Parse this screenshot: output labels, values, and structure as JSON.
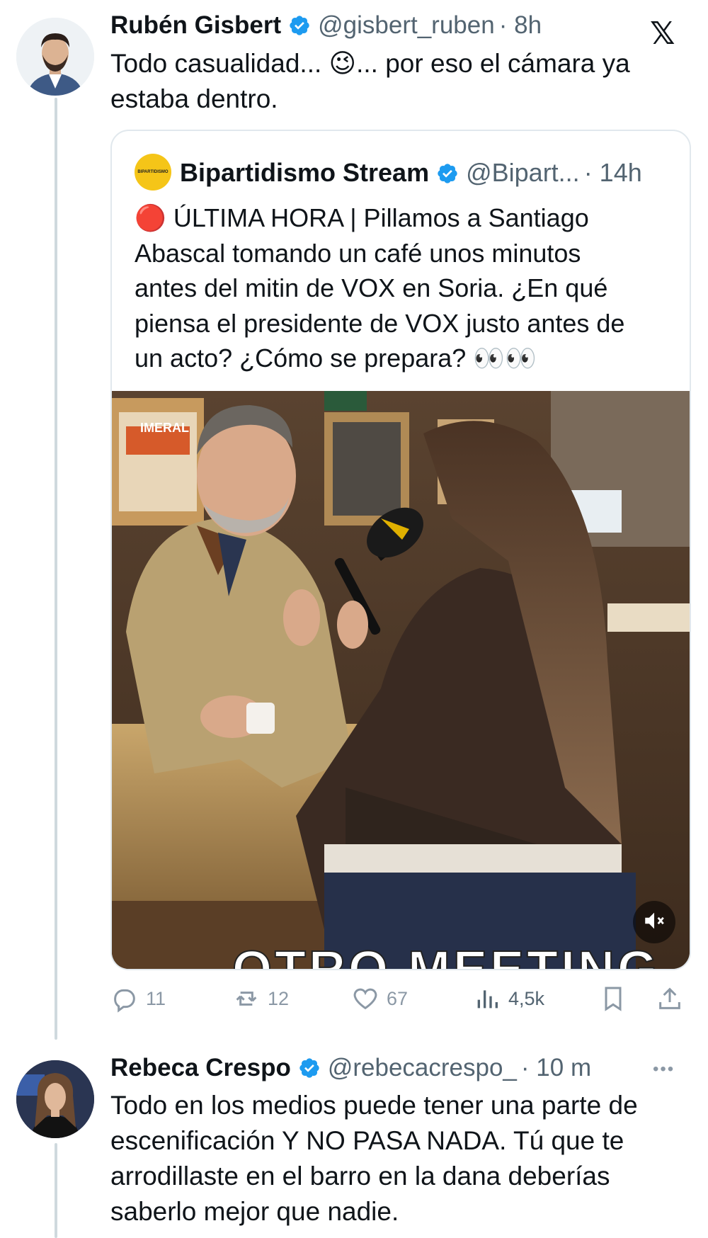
{
  "x_logo": "𝕏",
  "tweet1": {
    "name": "Rubén Gisbert",
    "handle": "@gisbert_ruben",
    "time": "· 8h",
    "text_lines": [
      "Todo casualidad... 😉... por eso el cámara ya",
      "estaba dentro."
    ],
    "quote": {
      "name": "Bipartidismo Stream",
      "handle": "@Bipart...",
      "time": "· 14h",
      "avatar_text": "BIPARTIDISMO",
      "text_lines": [
        "🔴 ÚLTIMA HORA | Pillamos a Santiago",
        "Abascal tomando un café unos minutos",
        "antes del mitin de VOX en Soria. ¿En qué",
        "piensa el presidente de VOX justo antes de",
        "un acto? ¿Cómo se prepara? 👀👀"
      ],
      "video_caption": "OTRO MEETING",
      "video_sign": "IMERAL"
    },
    "actions": {
      "replies": "11",
      "reposts": "12",
      "likes": "67",
      "views": "4,5k"
    }
  },
  "tweet2": {
    "name": "Rebeca Crespo",
    "handle": "@rebecacrespo_",
    "time": "· 10 m",
    "more": "•••",
    "text_lines": [
      "Todo en los medios puede tener una parte de",
      "escenificación Y NO PASA NADA. Tú que te",
      "arrodillaste en el barro en la dana deberías",
      "saberlo mejor que nadie."
    ]
  },
  "colors": {
    "verified": "#1d9bf0",
    "muted": "#536471",
    "action": "#8b98a5",
    "border": "#e1e8ed"
  }
}
